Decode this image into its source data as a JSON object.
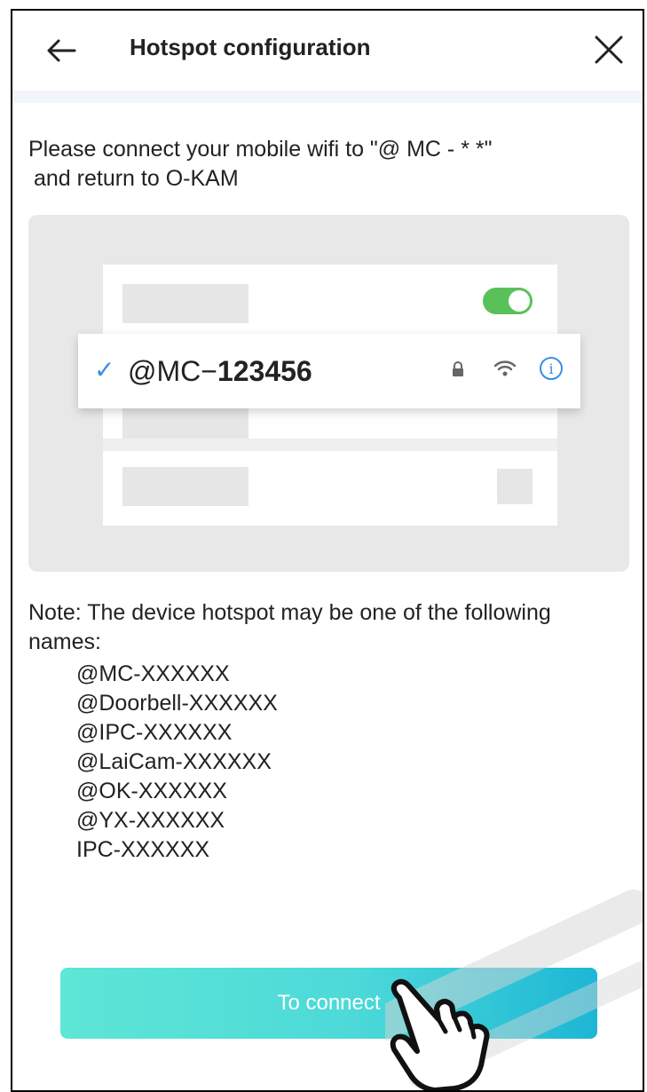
{
  "header": {
    "title": "Hotspot configuration",
    "back_icon": "arrow-left-icon",
    "close_icon": "close-icon"
  },
  "instruction": {
    "line1": "Please connect your mobile wifi to \"@ MC - * *\"",
    "line2": "and return to O-KAM"
  },
  "illustration": {
    "check_icon": "checkmark-icon",
    "ssid_prefix": "@MC−",
    "ssid_suffix": "123456",
    "toggle_state": "on",
    "icons": [
      "lock-icon",
      "wifi-signal-icon",
      "info-icon"
    ],
    "info_glyph": "i"
  },
  "note": {
    "text": "Note: The device hotspot may be one of the following names:",
    "names": [
      "@MC-XXXXXX",
      "@Doorbell-XXXXXX",
      "@IPC-XXXXXX",
      "@LaiCam-XXXXXX",
      "@OK-XXXXXX",
      "@YX-XXXXXX",
      "IPC-XXXXXX"
    ]
  },
  "actions": {
    "connect_label": "To connect"
  },
  "colors": {
    "accent_blue": "#3a8ee6",
    "toggle_green": "#5ac15a",
    "button_gradient_start": "#5ee6d6",
    "button_gradient_end": "#1db6d6"
  }
}
